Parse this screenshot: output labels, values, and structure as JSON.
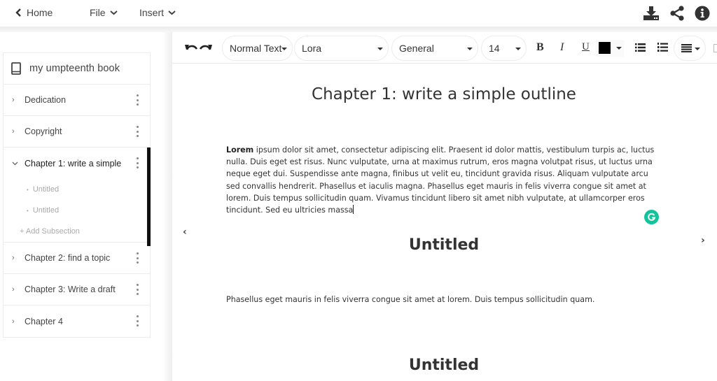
{
  "topbar": {
    "home_label": "Home",
    "file_label": "File",
    "insert_label": "Insert",
    "icons": [
      "download-icon",
      "share-icon",
      "info-icon"
    ]
  },
  "sidebar": {
    "book_title": "my umpteenth book",
    "items": [
      {
        "label": "Dedication",
        "expanded": false
      },
      {
        "label": "Copyright",
        "expanded": false
      },
      {
        "label": "Chapter 1: write a simple outline",
        "display_label": "Chapter 1: write a simple",
        "expanded": true,
        "active": true,
        "subsections": [
          {
            "label": "Untitled"
          },
          {
            "label": "Untitled"
          }
        ],
        "add_label": "+ Add Subsection"
      },
      {
        "label": "Chapter 2: find a topic",
        "expanded": false
      },
      {
        "label": "Chapter 3: Write a draft",
        "expanded": false
      },
      {
        "label": "Chapter 4",
        "expanded": false
      }
    ]
  },
  "toolbar": {
    "paragraph_style": "Normal Text",
    "font": "Lora",
    "category": "General",
    "font_size": "14",
    "bold_label": "B",
    "italic_label": "I",
    "underline_label": "U",
    "text_color": "#000000"
  },
  "editor": {
    "chapter_title": "Chapter 1: write a simple outline",
    "paragraph_bold": "Lorem",
    "paragraph_rest": " ipsum dolor sit amet, consectetur adipiscing elit. Praesent id dolor mattis, vestibulum turpis ac, luctus nulla. Duis eget est risus. Nunc vulputate, urna at maximus rutrum, eros magna volutpat risus, ut luctus urna neque eget dui. Suspendisse ante magna, finibus ut velit eu, tincidunt gravida risus. Aliquam vulputate arcu sed convallis hendrerit. Phasellus et iaculis magna. Phasellus eget mauris in felis viverra congue sit amet at lorem. Duis tempus sollicitudin quam. Vivamus tincidunt libero sit amet nibh vulputate, at ullamcorper eros tincidunt. Sed eu ultricies massa",
    "sections": [
      {
        "title": "Untitled",
        "text": "Phasellus eget mauris in felis viverra congue sit amet at lorem. Duis tempus sollicitudin quam."
      },
      {
        "title": "Untitled",
        "text": ""
      }
    ],
    "grammarly_color": "#15c39a"
  }
}
